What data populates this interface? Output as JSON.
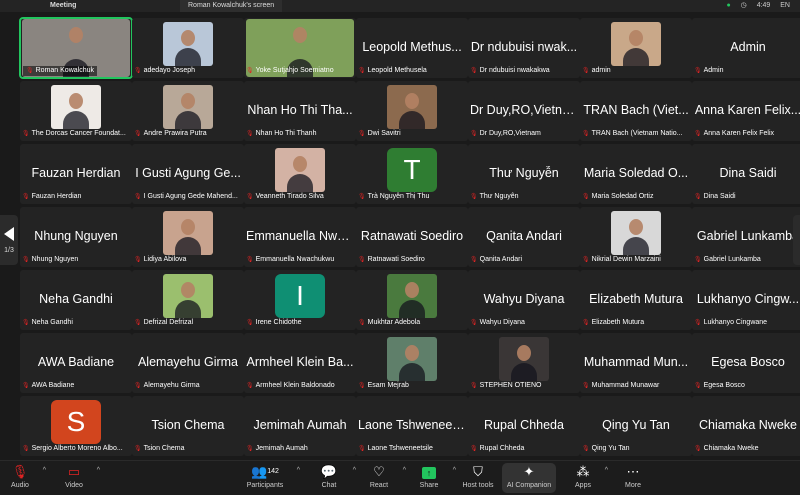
{
  "topbar": {
    "meeting": "Meeting",
    "share_label": "Roman Kowalchuk's screen",
    "time": "4:49",
    "lang": "EN"
  },
  "pager": {
    "count": "1/3"
  },
  "colors": {
    "active_border": "#22c55e",
    "muted_mic": "#e02424"
  },
  "tiles": [
    {
      "label": "Roman Kowalchuk",
      "big": "",
      "photo": "#8a8580",
      "wide": true,
      "active": true
    },
    {
      "label": "adedayo Joseph",
      "big": "",
      "photo": "#b9c7d8"
    },
    {
      "label": "Yoke Sutjahjo Soemiatno",
      "big": "",
      "photo": "#7fa05a",
      "wide": true
    },
    {
      "label": "Leopold Methusela",
      "big": "Leopold Methus..."
    },
    {
      "label": "Dr ndubuisi nwakakwa",
      "big": "Dr ndubuisi nwak..."
    },
    {
      "label": "admin",
      "big": "",
      "photo": "#c9a889"
    },
    {
      "label": "Admin",
      "big": "Admin"
    },
    {
      "label": "The Dorcas Cancer Foundat...",
      "big": "",
      "photo": "#eeeae6"
    },
    {
      "label": "Andre Prawira Putra",
      "big": "",
      "photo": "#b8a898"
    },
    {
      "label": "Nhan Ho Thi Thanh",
      "big": "Nhan Ho Thi Tha..."
    },
    {
      "label": "Dwi Savitri",
      "big": "",
      "photo": "#8c6a4e"
    },
    {
      "label": "Dr Duy,RO,Vietnam",
      "big": "Dr Duy,RO,Vietnam"
    },
    {
      "label": "TRAN Bach (Vietnam Natio...",
      "big": "TRAN Bach (Viet..."
    },
    {
      "label": "Anna Karen Felix Felix",
      "big": "Anna Karen Felix..."
    },
    {
      "label": "Fauzan Herdian",
      "big": "Fauzan Herdian"
    },
    {
      "label": "I Gusti Agung Gede Mahend...",
      "big": "I Gusti Agung Ge..."
    },
    {
      "label": "Veanneth Tirado Silva",
      "big": "",
      "photo": "#d3b2a4"
    },
    {
      "label": "Trà Nguyễn Thị Thu",
      "big": "",
      "avatar": "T",
      "avatar_color": "#2f7d32"
    },
    {
      "label": "Thư Nguyễn",
      "big": "Thư Nguyễn"
    },
    {
      "label": "Maria Soledad Ortiz",
      "big": "Maria Soledad O..."
    },
    {
      "label": "Dina Saidi",
      "big": "Dina Saidi"
    },
    {
      "label": "Nhung Nguyen",
      "big": "Nhung Nguyen"
    },
    {
      "label": "Lidiya Abilova",
      "big": "",
      "photo": "#c8a38e"
    },
    {
      "label": "Emmanuella Nwachukwu",
      "big": "Emmanuella Nwa..."
    },
    {
      "label": "Ratnawati Soediro",
      "big": "Ratnawati Soediro"
    },
    {
      "label": "Qanita Andari",
      "big": "Qanita Andari"
    },
    {
      "label": "Nikrial Dewin Marzaini",
      "big": "",
      "photo": "#d8d8d8"
    },
    {
      "label": "Gabriel Lunkamba",
      "big": "Gabriel Lunkamba"
    },
    {
      "label": "Neha Gandhi",
      "big": "Neha Gandhi"
    },
    {
      "label": "Defrizal Defrizal",
      "big": "",
      "photo": "#9bbf6e"
    },
    {
      "label": "Irene Chidothe",
      "big": "",
      "avatar": "I",
      "avatar_color": "#0f8f73"
    },
    {
      "label": "Mukhtar Adebola",
      "big": "",
      "photo": "#4a7a3e"
    },
    {
      "label": "Wahyu Diyana",
      "big": "Wahyu Diyana"
    },
    {
      "label": "Elizabeth Mutura",
      "big": "Elizabeth Mutura"
    },
    {
      "label": "Lukhanyo Cingwane",
      "big": "Lukhanyo Cingw..."
    },
    {
      "label": "AWA Badiane",
      "big": "AWA Badiane"
    },
    {
      "label": "Alemayehu Girma",
      "big": "Alemayehu Girma"
    },
    {
      "label": "Armheel Klein Baldonado",
      "big": "Armheel Klein Ba..."
    },
    {
      "label": "Esam Mejrab",
      "big": "",
      "photo": "#5f7f6a"
    },
    {
      "label": "STEPHEN OTIENO",
      "big": "",
      "photo": "#3a3636"
    },
    {
      "label": "Muhammad Munawar",
      "big": "Muhammad Mun..."
    },
    {
      "label": "Egesa Bosco",
      "big": "Egesa Bosco"
    },
    {
      "label": "Sergio Alberto Moreno Albo...",
      "big": "",
      "avatar": "S",
      "avatar_color": "#d2451e"
    },
    {
      "label": "Tsion Chema",
      "big": "Tsion Chema"
    },
    {
      "label": "Jemimah Aumah",
      "big": "Jemimah Aumah"
    },
    {
      "label": "Laone Tshweneetsile",
      "big": "Laone Tshweneee..."
    },
    {
      "label": "Rupal Chheda",
      "big": "Rupal Chheda"
    },
    {
      "label": "Qing Yu Tan",
      "big": "Qing Yu Tan"
    },
    {
      "label": "Chiamaka Nweke",
      "big": "Chiamaka Nweke"
    }
  ],
  "toolbar": {
    "audio": "Audio",
    "video": "Video",
    "participants": "Participants",
    "participants_count": "142",
    "chat": "Chat",
    "react": "React",
    "share": "Share",
    "host_tools": "Host tools",
    "ai_companion": "AI Companion",
    "apps": "Apps",
    "more": "More"
  }
}
